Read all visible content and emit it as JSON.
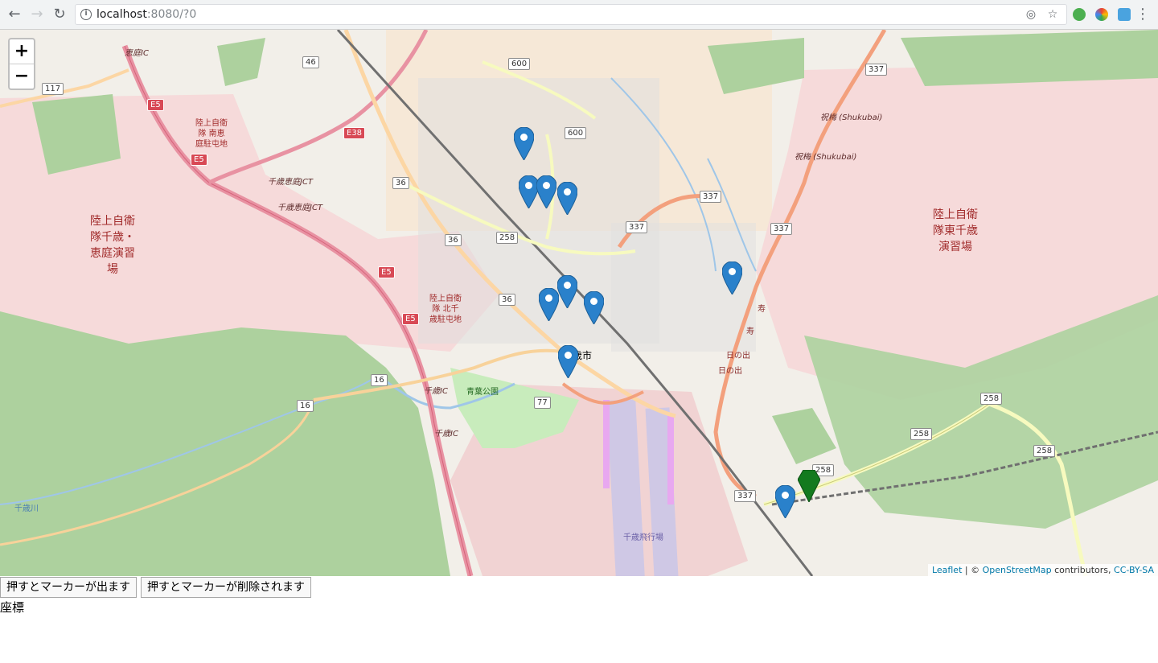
{
  "browser": {
    "url_host": "localhost",
    "url_rest": ":8080/?0"
  },
  "map": {
    "zoom_in": "+",
    "zoom_out": "−",
    "labels": {
      "training_area_west": [
        "陸上自衛",
        "隊千歳・",
        "恵庭演習",
        "場"
      ],
      "training_area_east": [
        "陸上自衛",
        "隊東千歳",
        "演習場"
      ],
      "camp_south_eniwa": [
        "陸上自衛",
        "隊 南恵",
        "庭駐屯地"
      ],
      "camp_north_chitose": [
        "陸上自衛",
        "隊 北千",
        "歳駐屯地"
      ],
      "city": "千歳市",
      "aoba_park": "青葉公園",
      "airport": "千歳飛行場",
      "shukubai_1": "祝梅 (Shukubai)",
      "shukubai_2": "祝梅 (Shukubai)",
      "kotobuki_1": "寿",
      "kotobuki_2": "寿",
      "hinode_1": "日の出",
      "hinode_2": "日の出",
      "eniwa_ic": "恵庭IC",
      "chitose_eniwa_jct_1": "千歳恵庭JCT",
      "chitose_eniwa_jct_2": "千歳恵庭JCT",
      "chitose_ic_1": "千歳IC",
      "chitose_ic_2": "千歳IC",
      "chitose_river": "千歳川"
    },
    "shields": [
      "46",
      "600",
      "600",
      "117",
      "36",
      "36",
      "36",
      "258",
      "337",
      "337",
      "337",
      "337",
      "16",
      "16",
      "77",
      "258",
      "258",
      "258",
      "258",
      "337"
    ],
    "expressway_shields": [
      "E5",
      "E5",
      "E5",
      "E5",
      "E38"
    ],
    "attribution": {
      "leaflet": "Leaflet",
      "sep": " | © ",
      "osm": "OpenStreetMap",
      "contributors": " contributors, ",
      "license": "CC-BY-SA"
    },
    "colors": {
      "marker_blue": "#2a81cb",
      "marker_green": "#137a1e",
      "military": "#f6dada",
      "forest": "#add19e",
      "motorway": "#e892a2",
      "primary": "#fcd6a4"
    }
  },
  "buttons": {
    "add_marker": "押すとマーカーが出ます",
    "remove_marker": "押すとマーカーが削除されます"
  },
  "coordinates_label": "座標"
}
